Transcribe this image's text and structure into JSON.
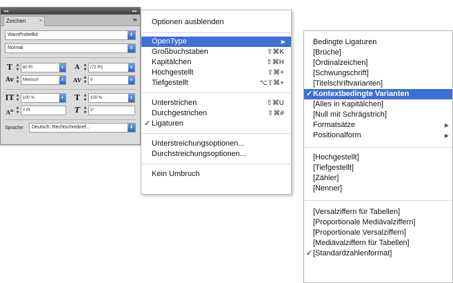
{
  "panel": {
    "tab_label": "Zeichen",
    "tab_close": "×",
    "title_left": "◂◂",
    "title_right": "▸▸",
    "menu_icon": "≡",
    "font_family": "WarnProbeBd",
    "font_style": "Normal",
    "size": "60 Pt",
    "leading": "(72 Pt)",
    "kerning": "Metrisch",
    "tracking": "0",
    "vscale": "100 %",
    "hscale": "100 %",
    "baseline": "0 Pt",
    "skew": "0°",
    "language_label": "Sprache:",
    "language_value": "Deutsch: Rechtschreibref..."
  },
  "menu": {
    "hide_options": "Optionen ausblenden",
    "opentype": "OpenType",
    "submenu_arrow": "▶",
    "caps": "Großbuchstaben",
    "caps_sc": "⇧⌘K",
    "small_caps": "Kapitälchen",
    "small_caps_sc": "⇧⌘H",
    "superscript": "Hochgestellt",
    "superscript_sc": "⇧⌘+",
    "subscript": "Tiefgestellt",
    "subscript_sc": "⌥⇧⌘+",
    "underline": "Unterstrichen",
    "underline_sc": "⇧⌘U",
    "strikethrough": "Durchgestrichen",
    "strikethrough_sc": "⇧⌘#",
    "ligatures": "Ligaturen",
    "check": "✓",
    "underline_options": "Unterstreichungsoptionen...",
    "strikethrough_options": "Durchstreichungsoptionen...",
    "no_break": "Kein Umbruch"
  },
  "submenu": {
    "items_group1": [
      "Bedingte Ligaturen",
      "[Brüche]",
      "[Ordinalzeichen]",
      "[Schwungschrift]",
      "[Titelschriftvarianten]",
      "Kontextbedingte Varianten",
      "[Alles in Kapitälchen]",
      "[Null mit Schrägstrich]",
      "Formatsätze",
      "Positionalform"
    ],
    "items_group2": [
      "[Hochgestellt]",
      "[Tiefgestellt]",
      "[Zähler]",
      "[Nenner]"
    ],
    "items_group3": [
      "[Versalziffern für Tabellen]",
      "[Proportionale Mediävalziffern]",
      "[Proportionale Versalziffern]",
      "[Mediävalziffern für Tabellen]",
      "[Standardzahlenformat]"
    ],
    "check": "✓",
    "arrow": "▶"
  },
  "colors": {
    "highlight": "#3d6fd9"
  }
}
